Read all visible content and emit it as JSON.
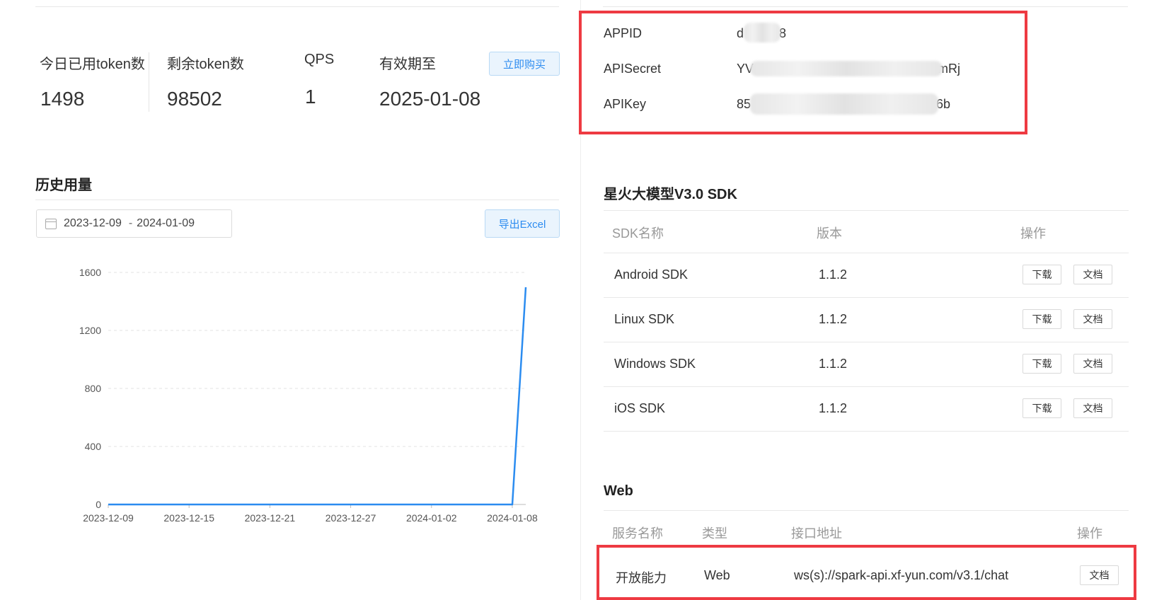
{
  "stats": {
    "today_used_label": "今日已用token数",
    "today_used_value": "1498",
    "remaining_label": "剩余token数",
    "remaining_value": "98502",
    "qps_label": "QPS",
    "qps_value": "1",
    "expire_label": "有效期至",
    "expire_value": "2025-01-08",
    "buy_button": "立即购买"
  },
  "history": {
    "title": "历史用量",
    "date_start": "2023-12-09",
    "date_sep": "-",
    "date_end": "2024-01-09",
    "export_button": "导出Excel"
  },
  "chart_data": {
    "type": "line",
    "x": [
      "2023-12-09",
      "2023-12-10",
      "2023-12-11",
      "2023-12-12",
      "2023-12-13",
      "2023-12-14",
      "2023-12-15",
      "2023-12-16",
      "2023-12-17",
      "2023-12-18",
      "2023-12-19",
      "2023-12-20",
      "2023-12-21",
      "2023-12-22",
      "2023-12-23",
      "2023-12-24",
      "2023-12-25",
      "2023-12-26",
      "2023-12-27",
      "2023-12-28",
      "2023-12-29",
      "2023-12-30",
      "2023-12-31",
      "2024-01-01",
      "2024-01-02",
      "2024-01-03",
      "2024-01-04",
      "2024-01-05",
      "2024-01-06",
      "2024-01-07",
      "2024-01-08",
      "2024-01-09"
    ],
    "values": [
      0,
      0,
      0,
      0,
      0,
      0,
      0,
      0,
      0,
      0,
      0,
      0,
      0,
      0,
      0,
      0,
      0,
      0,
      0,
      0,
      0,
      0,
      0,
      0,
      0,
      0,
      0,
      0,
      0,
      0,
      0,
      1498
    ],
    "xticks": [
      "2023-12-09",
      "2023-12-15",
      "2023-12-21",
      "2023-12-27",
      "2024-01-02",
      "2024-01-08"
    ],
    "yticks": [
      0,
      400,
      800,
      1200,
      1600
    ],
    "ylim": [
      0,
      1600
    ],
    "grid": true,
    "color": "#2b8cf0"
  },
  "credentials": {
    "appid_label": "APPID",
    "appid_prefix": "d",
    "appid_suffix": "8",
    "apisecret_label": "APISecret",
    "apisecret_prefix": "YV",
    "apisecret_suffix": "mRj",
    "apikey_label": "APIKey",
    "apikey_prefix": "85",
    "apikey_suffix": "6b"
  },
  "sdk": {
    "title": "星火大模型V3.0 SDK",
    "headers": [
      "SDK名称",
      "版本",
      "操作"
    ],
    "rows": [
      {
        "name": "Android SDK",
        "version": "1.1.2",
        "download": "下载",
        "docs": "文档"
      },
      {
        "name": "Linux SDK",
        "version": "1.1.2",
        "download": "下载",
        "docs": "文档"
      },
      {
        "name": "Windows SDK",
        "version": "1.1.2",
        "download": "下载",
        "docs": "文档"
      },
      {
        "name": "iOS SDK",
        "version": "1.1.2",
        "download": "下载",
        "docs": "文档"
      }
    ]
  },
  "web": {
    "title": "Web",
    "headers": [
      "服务名称",
      "类型",
      "接口地址",
      "操作"
    ],
    "row": {
      "name": "开放能力",
      "type": "Web",
      "url": "ws(s)://spark-api.xf-yun.com/v3.1/chat",
      "docs": "文档"
    }
  },
  "colors": {
    "accent": "#2d8cf0",
    "highlight_red": "#ee3a42"
  }
}
